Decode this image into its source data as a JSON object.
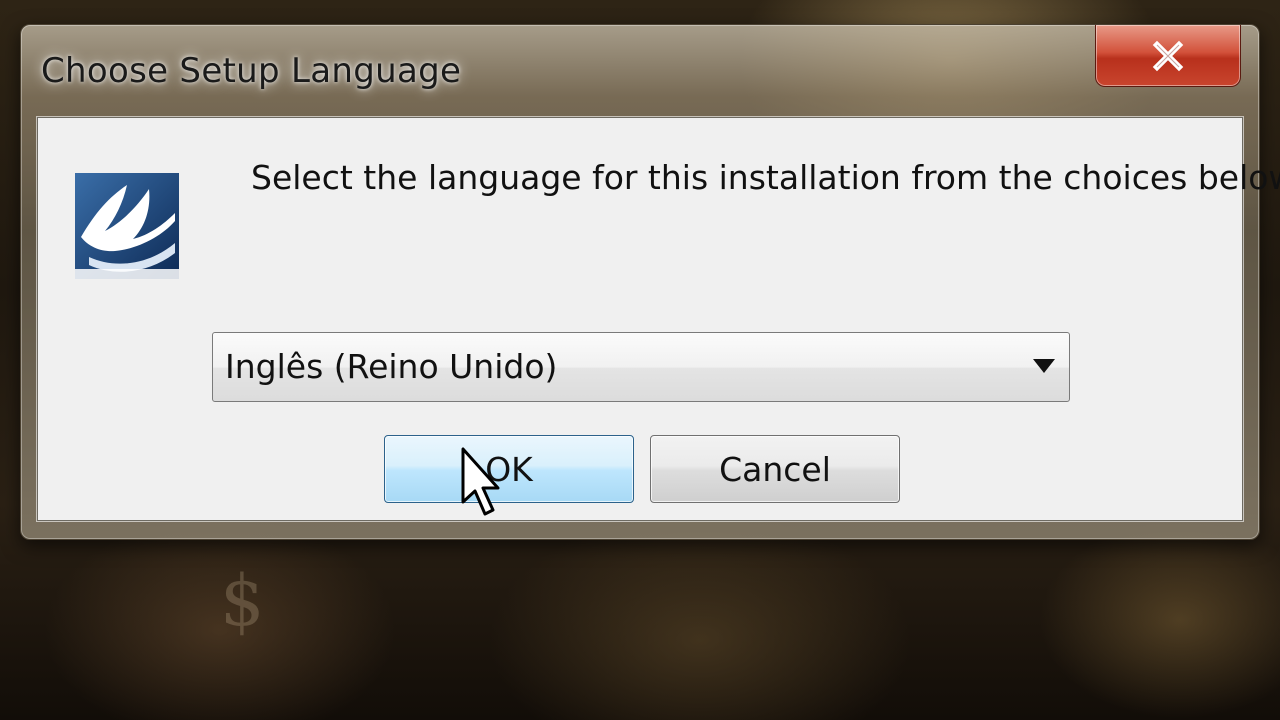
{
  "dialog": {
    "title": "Choose Setup Language",
    "prompt": "Select the language for this installation from the choices below.",
    "language_select": {
      "selected": "Inglês (Reino Unido)"
    },
    "ok_label": "OK",
    "cancel_label": "Cancel"
  },
  "icons": {
    "close": "close-icon",
    "app_logo": "installer-logo-icon",
    "dropdown": "chevron-down-icon",
    "cursor": "mouse-pointer-icon"
  },
  "colors": {
    "close_button": "#c9452e",
    "ok_button": "#bee6fd",
    "client_background": "#f0f0f0"
  }
}
